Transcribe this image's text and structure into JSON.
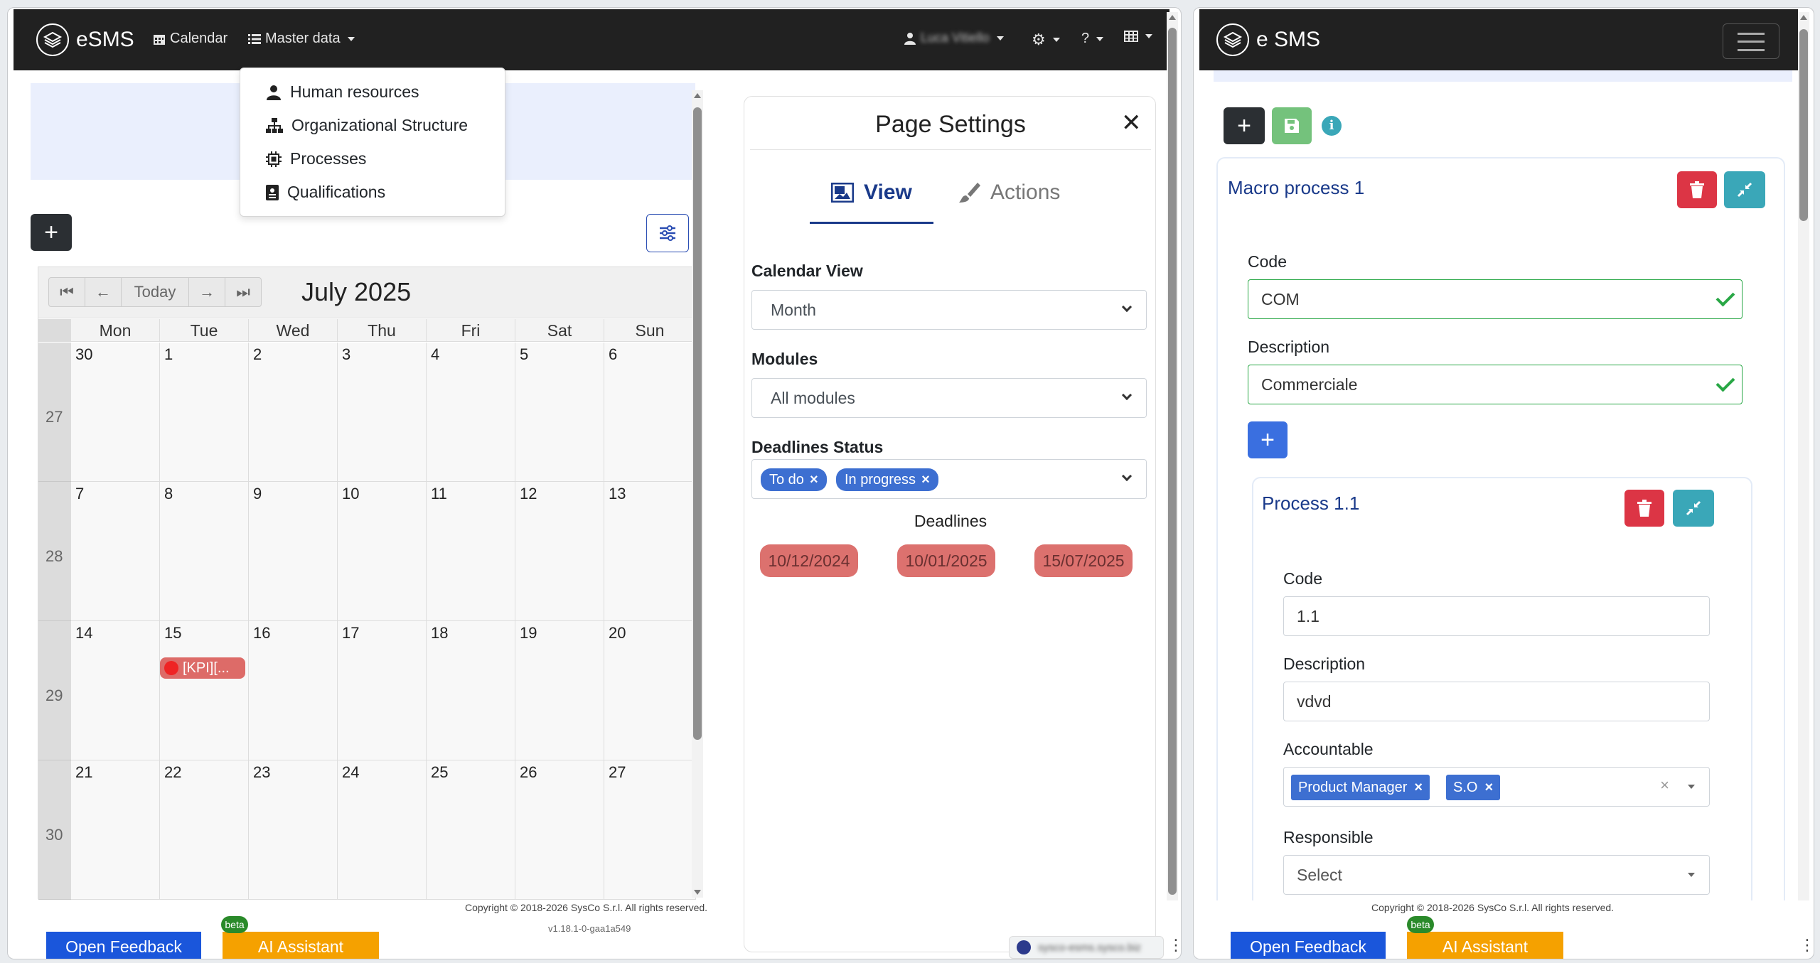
{
  "left": {
    "brand": "eSMS",
    "nav": {
      "calendar": "Calendar",
      "master_data": "Master data"
    },
    "user_name": "Luca Vitiello",
    "help": "?",
    "menu": {
      "human_resources": "Human resources",
      "org_structure": "Organizational Structure",
      "processes": "Processes",
      "qualifications": "Qualifications"
    },
    "calendar": {
      "title": "July 2025",
      "today": "Today",
      "days_of_week": [
        "Mon",
        "Tue",
        "Wed",
        "Thu",
        "Fri",
        "Sat",
        "Sun"
      ],
      "weeks": [
        {
          "num": "27",
          "days": [
            "30",
            "1",
            "2",
            "3",
            "4",
            "5",
            "6"
          ]
        },
        {
          "num": "28",
          "days": [
            "7",
            "8",
            "9",
            "10",
            "11",
            "12",
            "13"
          ]
        },
        {
          "num": "29",
          "days": [
            "14",
            "15",
            "16",
            "17",
            "18",
            "19",
            "20"
          ]
        },
        {
          "num": "30",
          "days": [
            "21",
            "22",
            "23",
            "24",
            "25",
            "26",
            "27"
          ]
        }
      ],
      "event_label": "[KPI][..."
    },
    "settings": {
      "title": "Page Settings",
      "tab_view": "View",
      "tab_actions": "Actions",
      "calendar_view_label": "Calendar View",
      "calendar_view_value": "Month",
      "modules_label": "Modules",
      "modules_value": "All modules",
      "deadlines_status_label": "Deadlines Status",
      "status_tags": [
        "To do",
        "In progress"
      ],
      "deadlines_label": "Deadlines",
      "deadlines": [
        "10/12/2024",
        "10/01/2025",
        "15/07/2025"
      ]
    },
    "footer": {
      "copyright": "Copyright © 2018-2026 SysCo S.r.l. All rights reserved.",
      "version": "v1.18.1-0-gaa1a549",
      "feedback": "Open Feedback",
      "ai": "AI Assistant",
      "beta": "beta"
    },
    "url_blurred": "sysco-esms.sysco.biz"
  },
  "right": {
    "brand": "e SMS",
    "macro": {
      "title": "Macro process 1",
      "code_label": "Code",
      "code_value": "COM",
      "desc_label": "Description",
      "desc_value": "Commerciale"
    },
    "process": {
      "title": "Process 1.1",
      "code_label": "Code",
      "code_value": "1.1",
      "desc_label": "Description",
      "desc_value": "vdvd",
      "accountable_label": "Accountable",
      "accountable_tags": [
        "Product Manager",
        "S.O"
      ],
      "responsible_label": "Responsible",
      "responsible_placeholder": "Select"
    },
    "footer": {
      "copyright": "Copyright © 2018-2026 SysCo S.r.l. All rights reserved.",
      "feedback": "Open Feedback",
      "ai": "AI Assistant",
      "beta": "beta"
    }
  },
  "colors": {
    "navbar": "#212121",
    "primary": "#3d6fd1",
    "danger": "#dc3545",
    "info": "#3aa7b8",
    "success": "#28a745",
    "feedback": "#1a56db",
    "ai": "#f5a100",
    "deadline": "#d9625f"
  }
}
